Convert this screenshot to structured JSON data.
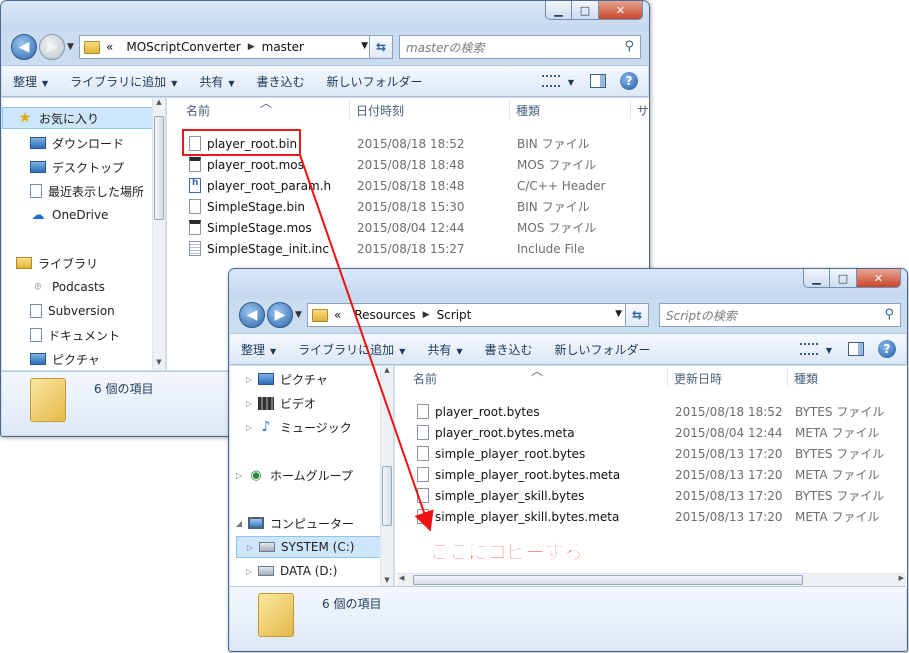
{
  "window_top": {
    "address": {
      "overflow": "«",
      "crumbs": [
        "MOScriptConverter",
        "master"
      ]
    },
    "search_placeholder": "masterの検索",
    "toolbar": {
      "organize": "整理",
      "add_library": "ライブラリに追加",
      "share": "共有",
      "burn": "書き込む",
      "new_folder": "新しいフォルダー"
    },
    "nav": [
      {
        "label": "お気に入り",
        "icon": "star-icon",
        "selected": true
      },
      {
        "label": "ダウンロード",
        "icon": "download-folder-icon"
      },
      {
        "label": "デスクトップ",
        "icon": "desktop-icon"
      },
      {
        "label": "最近表示した場所",
        "icon": "recent-places-icon"
      },
      {
        "label": "OneDrive",
        "icon": "onedrive-icon"
      },
      {
        "label": "ライブラリ",
        "icon": "library-icon"
      },
      {
        "label": "Podcasts",
        "icon": "podcast-icon"
      },
      {
        "label": "Subversion",
        "icon": "document-icon"
      },
      {
        "label": "ドキュメント",
        "icon": "documents-icon"
      },
      {
        "label": "ピクチャ",
        "icon": "pictures-icon"
      }
    ],
    "columns": {
      "name": "名前",
      "date": "日付時刻",
      "type": "種類",
      "extra": "サ"
    },
    "files": [
      {
        "name": "player_root.bin",
        "date": "2015/08/18 18:52",
        "type": "BIN ファイル",
        "icon": "bin-file-icon"
      },
      {
        "name": "player_root.mos",
        "date": "2015/08/18 18:48",
        "type": "MOS ファイル",
        "icon": "mos-file-icon"
      },
      {
        "name": "player_root_param.h",
        "date": "2015/08/18 18:48",
        "type": "C/C++ Header",
        "icon": "header-file-icon"
      },
      {
        "name": "SimpleStage.bin",
        "date": "2015/08/18 15:30",
        "type": "BIN ファイル",
        "icon": "bin-file-icon"
      },
      {
        "name": "SimpleStage.mos",
        "date": "2015/08/04 12:44",
        "type": "MOS ファイル",
        "icon": "mos-file-icon"
      },
      {
        "name": "SimpleStage_init.inc",
        "date": "2015/08/18 15:27",
        "type": "Include File",
        "icon": "include-file-icon"
      }
    ],
    "status": "6 個の項目"
  },
  "window_bottom": {
    "address": {
      "overflow": "«",
      "crumbs": [
        "Resources",
        "Script"
      ]
    },
    "search_placeholder": "Scriptの検索",
    "toolbar": {
      "organize": "整理",
      "add_library": "ライブラリに追加",
      "share": "共有",
      "burn": "書き込む",
      "new_folder": "新しいフォルダー"
    },
    "nav": [
      {
        "label": "ピクチャ",
        "icon": "pictures-icon"
      },
      {
        "label": "ビデオ",
        "icon": "video-icon"
      },
      {
        "label": "ミュージック",
        "icon": "music-icon"
      },
      {
        "label": "ホームグループ",
        "icon": "homegroup-icon"
      },
      {
        "label": "コンピューター",
        "icon": "computer-icon"
      },
      {
        "label": "SYSTEM (C:)",
        "icon": "system-drive-icon",
        "selected": true
      },
      {
        "label": "DATA (D:)",
        "icon": "drive-icon"
      }
    ],
    "columns": {
      "name": "名前",
      "date": "更新日時",
      "type": "種類"
    },
    "files": [
      {
        "name": "player_root.bytes",
        "date": "2015/08/18 18:52",
        "type": "BYTES ファイル"
      },
      {
        "name": "player_root.bytes.meta",
        "date": "2015/08/04 12:44",
        "type": "META ファイル"
      },
      {
        "name": "simple_player_root.bytes",
        "date": "2015/08/13 17:20",
        "type": "BYTES ファイル"
      },
      {
        "name": "simple_player_root.bytes.meta",
        "date": "2015/08/13 17:20",
        "type": "META ファイル"
      },
      {
        "name": "simple_player_skill.bytes",
        "date": "2015/08/13 17:20",
        "type": "BYTES ファイル"
      },
      {
        "name": "simple_player_skill.bytes.meta",
        "date": "2015/08/13 17:20",
        "type": "META ファイル"
      }
    ],
    "status": "6 個の項目"
  },
  "annotation": {
    "text": "ここにコピーする",
    "color": "#ee1111"
  }
}
